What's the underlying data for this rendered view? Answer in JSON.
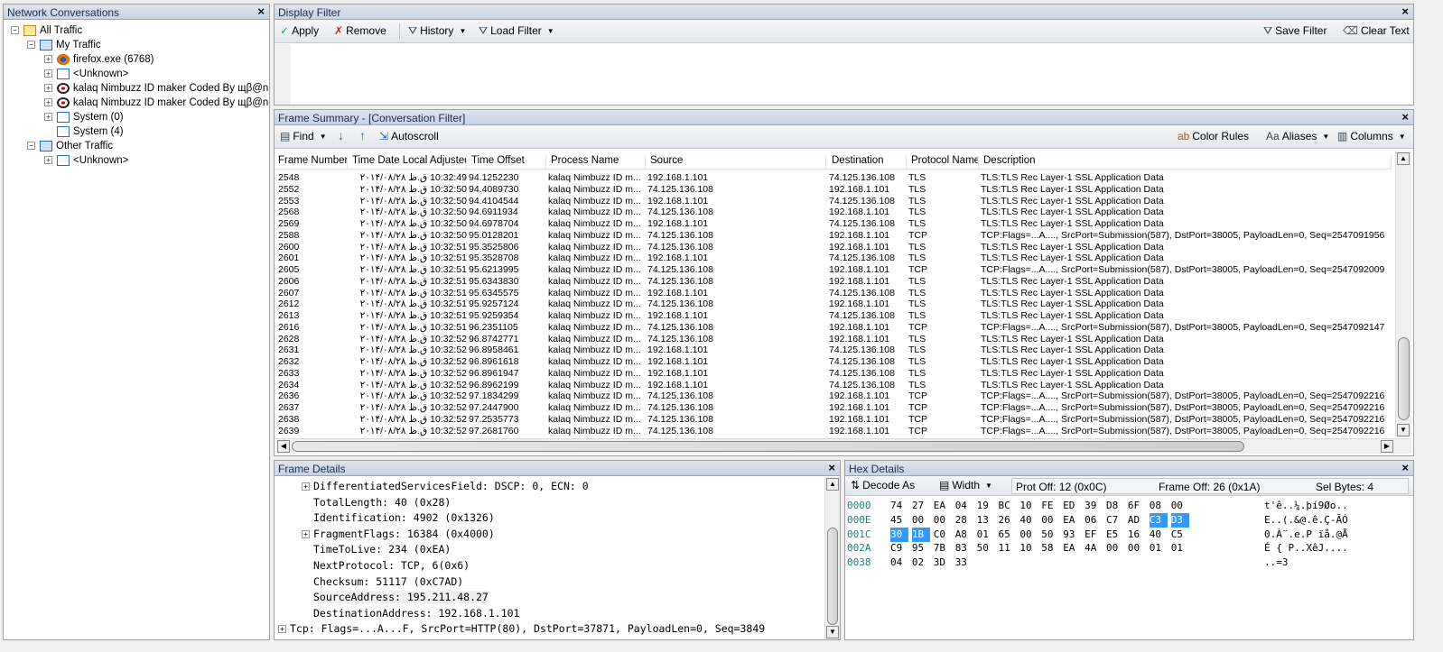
{
  "network": {
    "title": "Network Conversations",
    "nodes": [
      {
        "label": "All Traffic"
      },
      {
        "label": "My Traffic"
      },
      {
        "label": "firefox.exe (6768)"
      },
      {
        "label": "<Unknown>"
      },
      {
        "label": "kalaq Nimbuzz ID maker Coded By щβ@n.c.exe"
      },
      {
        "label": "kalaq Nimbuzz ID maker Coded By щβ@n.c.exe"
      },
      {
        "label": "System (0)"
      },
      {
        "label": "System (4)"
      },
      {
        "label": "Other Traffic"
      },
      {
        "label": "<Unknown>"
      }
    ]
  },
  "display_filter": {
    "title": "Display Filter",
    "apply": "Apply",
    "remove": "Remove",
    "history": "History",
    "load_filter": "Load Filter",
    "save_filter": "Save Filter",
    "clear_text": "Clear Text",
    "filter_text": ""
  },
  "frame_summary": {
    "title": "Frame Summary - [Conversation Filter]",
    "find": "Find",
    "autoscroll": "Autoscroll",
    "color_rules": "Color Rules",
    "aliases": "Aliases",
    "columns": "Columns",
    "headers": [
      "Frame Number",
      "Time Date Local Adjusted",
      "Time Offset",
      "Process Name",
      "Source",
      "Destination",
      "Protocol Name",
      "Description"
    ],
    "rows": [
      [
        "2548",
        "10:32:49 ق.ظ ۲۰۱۴/۰۸/۲۸",
        "94.1252230",
        "kalaq Nimbuzz ID m...",
        "192.168.1.101",
        "74.125.136.108",
        "TLS",
        "TLS:TLS Rec Layer-1 SSL Application Data"
      ],
      [
        "2552",
        "10:32:50 ق.ظ ۲۰۱۴/۰۸/۲۸",
        "94.4089730",
        "kalaq Nimbuzz ID m...",
        "74.125.136.108",
        "192.168.1.101",
        "TLS",
        "TLS:TLS Rec Layer-1 SSL Application Data"
      ],
      [
        "2553",
        "10:32:50 ق.ظ ۲۰۱۴/۰۸/۲۸",
        "94.4104544",
        "kalaq Nimbuzz ID m...",
        "192.168.1.101",
        "74.125.136.108",
        "TLS",
        "TLS:TLS Rec Layer-1 SSL Application Data"
      ],
      [
        "2568",
        "10:32:50 ق.ظ ۲۰۱۴/۰۸/۲۸",
        "94.6911934",
        "kalaq Nimbuzz ID m...",
        "74.125.136.108",
        "192.168.1.101",
        "TLS",
        "TLS:TLS Rec Layer-1 SSL Application Data"
      ],
      [
        "2569",
        "10:32:50 ق.ظ ۲۰۱۴/۰۸/۲۸",
        "94.6978704",
        "kalaq Nimbuzz ID m...",
        "192.168.1.101",
        "74.125.136.108",
        "TLS",
        "TLS:TLS Rec Layer-1 SSL Application Data"
      ],
      [
        "2588",
        "10:32:50 ق.ظ ۲۰۱۴/۰۸/۲۸",
        "95.0128201",
        "kalaq Nimbuzz ID m...",
        "74.125.136.108",
        "192.168.1.101",
        "TCP",
        "TCP:Flags=...A...., SrcPort=Submission(587), DstPort=38005, PayloadLen=0, Seq=2547091956"
      ],
      [
        "2600",
        "10:32:51 ق.ظ ۲۰۱۴/۰۸/۲۸",
        "95.3525806",
        "kalaq Nimbuzz ID m...",
        "74.125.136.108",
        "192.168.1.101",
        "TLS",
        "TLS:TLS Rec Layer-1 SSL Application Data"
      ],
      [
        "2601",
        "10:32:51 ق.ظ ۲۰۱۴/۰۸/۲۸",
        "95.3528708",
        "kalaq Nimbuzz ID m...",
        "192.168.1.101",
        "74.125.136.108",
        "TLS",
        "TLS:TLS Rec Layer-1 SSL Application Data"
      ],
      [
        "2605",
        "10:32:51 ق.ظ ۲۰۱۴/۰۸/۲۸",
        "95.6213995",
        "kalaq Nimbuzz ID m...",
        "74.125.136.108",
        "192.168.1.101",
        "TCP",
        "TCP:Flags=...A...., SrcPort=Submission(587), DstPort=38005, PayloadLen=0, Seq=2547092009"
      ],
      [
        "2606",
        "10:32:51 ق.ظ ۲۰۱۴/۰۸/۲۸",
        "95.6343830",
        "kalaq Nimbuzz ID m...",
        "74.125.136.108",
        "192.168.1.101",
        "TLS",
        "TLS:TLS Rec Layer-1 SSL Application Data"
      ],
      [
        "2607",
        "10:32:51 ق.ظ ۲۰۱۴/۰۸/۲۸",
        "95.6345575",
        "kalaq Nimbuzz ID m...",
        "192.168.1.101",
        "74.125.136.108",
        "TLS",
        "TLS:TLS Rec Layer-1 SSL Application Data"
      ],
      [
        "2612",
        "10:32:51 ق.ظ ۲۰۱۴/۰۸/۲۸",
        "95.9257124",
        "kalaq Nimbuzz ID m...",
        "74.125.136.108",
        "192.168.1.101",
        "TLS",
        "TLS:TLS Rec Layer-1 SSL Application Data"
      ],
      [
        "2613",
        "10:32:51 ق.ظ ۲۰۱۴/۰۸/۲۸",
        "95.9259354",
        "kalaq Nimbuzz ID m...",
        "192.168.1.101",
        "74.125.136.108",
        "TLS",
        "TLS:TLS Rec Layer-1 SSL Application Data"
      ],
      [
        "2616",
        "10:32:51 ق.ظ ۲۰۱۴/۰۸/۲۸",
        "96.2351105",
        "kalaq Nimbuzz ID m...",
        "74.125.136.108",
        "192.168.1.101",
        "TCP",
        "TCP:Flags=...A...., SrcPort=Submission(587), DstPort=38005, PayloadLen=0, Seq=2547092147"
      ],
      [
        "2628",
        "10:32:52 ق.ظ ۲۰۱۴/۰۸/۲۸",
        "96.8742771",
        "kalaq Nimbuzz ID m...",
        "74.125.136.108",
        "192.168.1.101",
        "TLS",
        "TLS:TLS Rec Layer-1 SSL Application Data"
      ],
      [
        "2631",
        "10:32:52 ق.ظ ۲۰۱۴/۰۸/۲۸",
        "96.8958461",
        "kalaq Nimbuzz ID m...",
        "192.168.1.101",
        "74.125.136.108",
        "TLS",
        "TLS:TLS Rec Layer-1 SSL Application Data"
      ],
      [
        "2632",
        "10:32:52 ق.ظ ۲۰۱۴/۰۸/۲۸",
        "96.8961618",
        "kalaq Nimbuzz ID m...",
        "192.168.1.101",
        "74.125.136.108",
        "TLS",
        "TLS:TLS Rec Layer-1 SSL Application Data"
      ],
      [
        "2633",
        "10:32:52 ق.ظ ۲۰۱۴/۰۸/۲۸",
        "96.8961947",
        "kalaq Nimbuzz ID m...",
        "192.168.1.101",
        "74.125.136.108",
        "TLS",
        "TLS:TLS Rec Layer-1 SSL Application Data"
      ],
      [
        "2634",
        "10:32:52 ق.ظ ۲۰۱۴/۰۸/۲۸",
        "96.8962199",
        "kalaq Nimbuzz ID m...",
        "192.168.1.101",
        "74.125.136.108",
        "TLS",
        "TLS:TLS Rec Layer-1 SSL Application Data"
      ],
      [
        "2636",
        "10:32:52 ق.ظ ۲۰۱۴/۰۸/۲۸",
        "97.1834299",
        "kalaq Nimbuzz ID m...",
        "74.125.136.108",
        "192.168.1.101",
        "TCP",
        "TCP:Flags=...A...., SrcPort=Submission(587), DstPort=38005, PayloadLen=0, Seq=2547092216"
      ],
      [
        "2637",
        "10:32:52 ق.ظ ۲۰۱۴/۰۸/۲۸",
        "97.2447900",
        "kalaq Nimbuzz ID m...",
        "74.125.136.108",
        "192.168.1.101",
        "TCP",
        "TCP:Flags=...A...., SrcPort=Submission(587), DstPort=38005, PayloadLen=0, Seq=2547092216"
      ],
      [
        "2638",
        "10:32:52 ق.ظ ۲۰۱۴/۰۸/۲۸",
        "97.2535773",
        "kalaq Nimbuzz ID m...",
        "74.125.136.108",
        "192.168.1.101",
        "TCP",
        "TCP:Flags=...A...., SrcPort=Submission(587), DstPort=38005, PayloadLen=0, Seq=2547092216"
      ],
      [
        "2639",
        "10:32:52 ق.ظ ۲۰۱۴/۰۸/۲۸",
        "97.2681760",
        "kalaq Nimbuzz ID m...",
        "74.125.136.108",
        "192.168.1.101",
        "TCP",
        "TCP:Flags=...A...., SrcPort=Submission(587), DstPort=38005, PayloadLen=0, Seq=2547092216"
      ]
    ]
  },
  "frame_details": {
    "title": "Frame Details",
    "lines": [
      {
        "text": "DifferentiatedServicesField: DSCP: 0, ECN: 0",
        "expandable": true,
        "highlight": false
      },
      {
        "text": "TotalLength: 40 (0x28)",
        "expandable": false,
        "highlight": false
      },
      {
        "text": "Identification: 4902 (0x1326)",
        "expandable": false,
        "highlight": false
      },
      {
        "text": "FragmentFlags: 16384 (0x4000)",
        "expandable": true,
        "highlight": false
      },
      {
        "text": "TimeToLive: 234 (0xEA)",
        "expandable": false,
        "highlight": false
      },
      {
        "text": "NextProtocol: TCP, 6(0x6)",
        "expandable": false,
        "highlight": false
      },
      {
        "text": "Checksum: 51117 (0xC7AD)",
        "expandable": false,
        "highlight": false
      },
      {
        "text": "SourceAddress: 195.211.48.27",
        "expandable": false,
        "highlight": true
      },
      {
        "text": "DestinationAddress: 192.168.1.101",
        "expandable": false,
        "highlight": false
      }
    ],
    "tcp_line": "Tcp: Flags=...A...F, SrcPort=HTTP(80), DstPort=37871, PayloadLen=0, Seq=3849"
  },
  "hex_details": {
    "title": "Hex Details",
    "decode_as": "Decode As",
    "width": "Width",
    "prot_off": "Prot Off: 12 (0x0C)",
    "frame_off": "Frame Off: 26 (0x1A)",
    "sel_bytes": "Sel Bytes: 4",
    "rows": [
      {
        "offset": "0000",
        "bytes": [
          "74",
          "27",
          "EA",
          "04",
          "19",
          "BC",
          "10",
          "FE",
          "ED",
          "39",
          "D8",
          "6F",
          "08",
          "00"
        ],
        "ascii": "t'ê..¼.þí9Øo.."
      },
      {
        "offset": "000E",
        "bytes": [
          "45",
          "00",
          "00",
          "28",
          "13",
          "26",
          "40",
          "00",
          "EA",
          "06",
          "C7",
          "AD",
          "C3",
          "D3"
        ],
        "ascii": "E..(.&@.ê.Ç-ÃÓ"
      },
      {
        "offset": "001C",
        "bytes": [
          "30",
          "1B",
          "C0",
          "A8",
          "01",
          "65",
          "00",
          "50",
          "93",
          "EF",
          "E5",
          "16",
          "40",
          "C5"
        ],
        "ascii": "0.À¨.e.P ïå.@Å"
      },
      {
        "offset": "002A",
        "bytes": [
          "C9",
          "95",
          "7B",
          "83",
          "50",
          "11",
          "10",
          "58",
          "EA",
          "4A",
          "00",
          "00",
          "01",
          "01"
        ],
        "ascii": "É { P..XêJ...."
      },
      {
        "offset": "0038",
        "bytes": [
          "04",
          "02",
          "3D",
          "33"
        ],
        "ascii": "..=3"
      }
    ]
  },
  "colors": {
    "panel_title": "#c8d2e2",
    "selection": "#3399ff",
    "hex_offset": "#1a7f7f"
  }
}
